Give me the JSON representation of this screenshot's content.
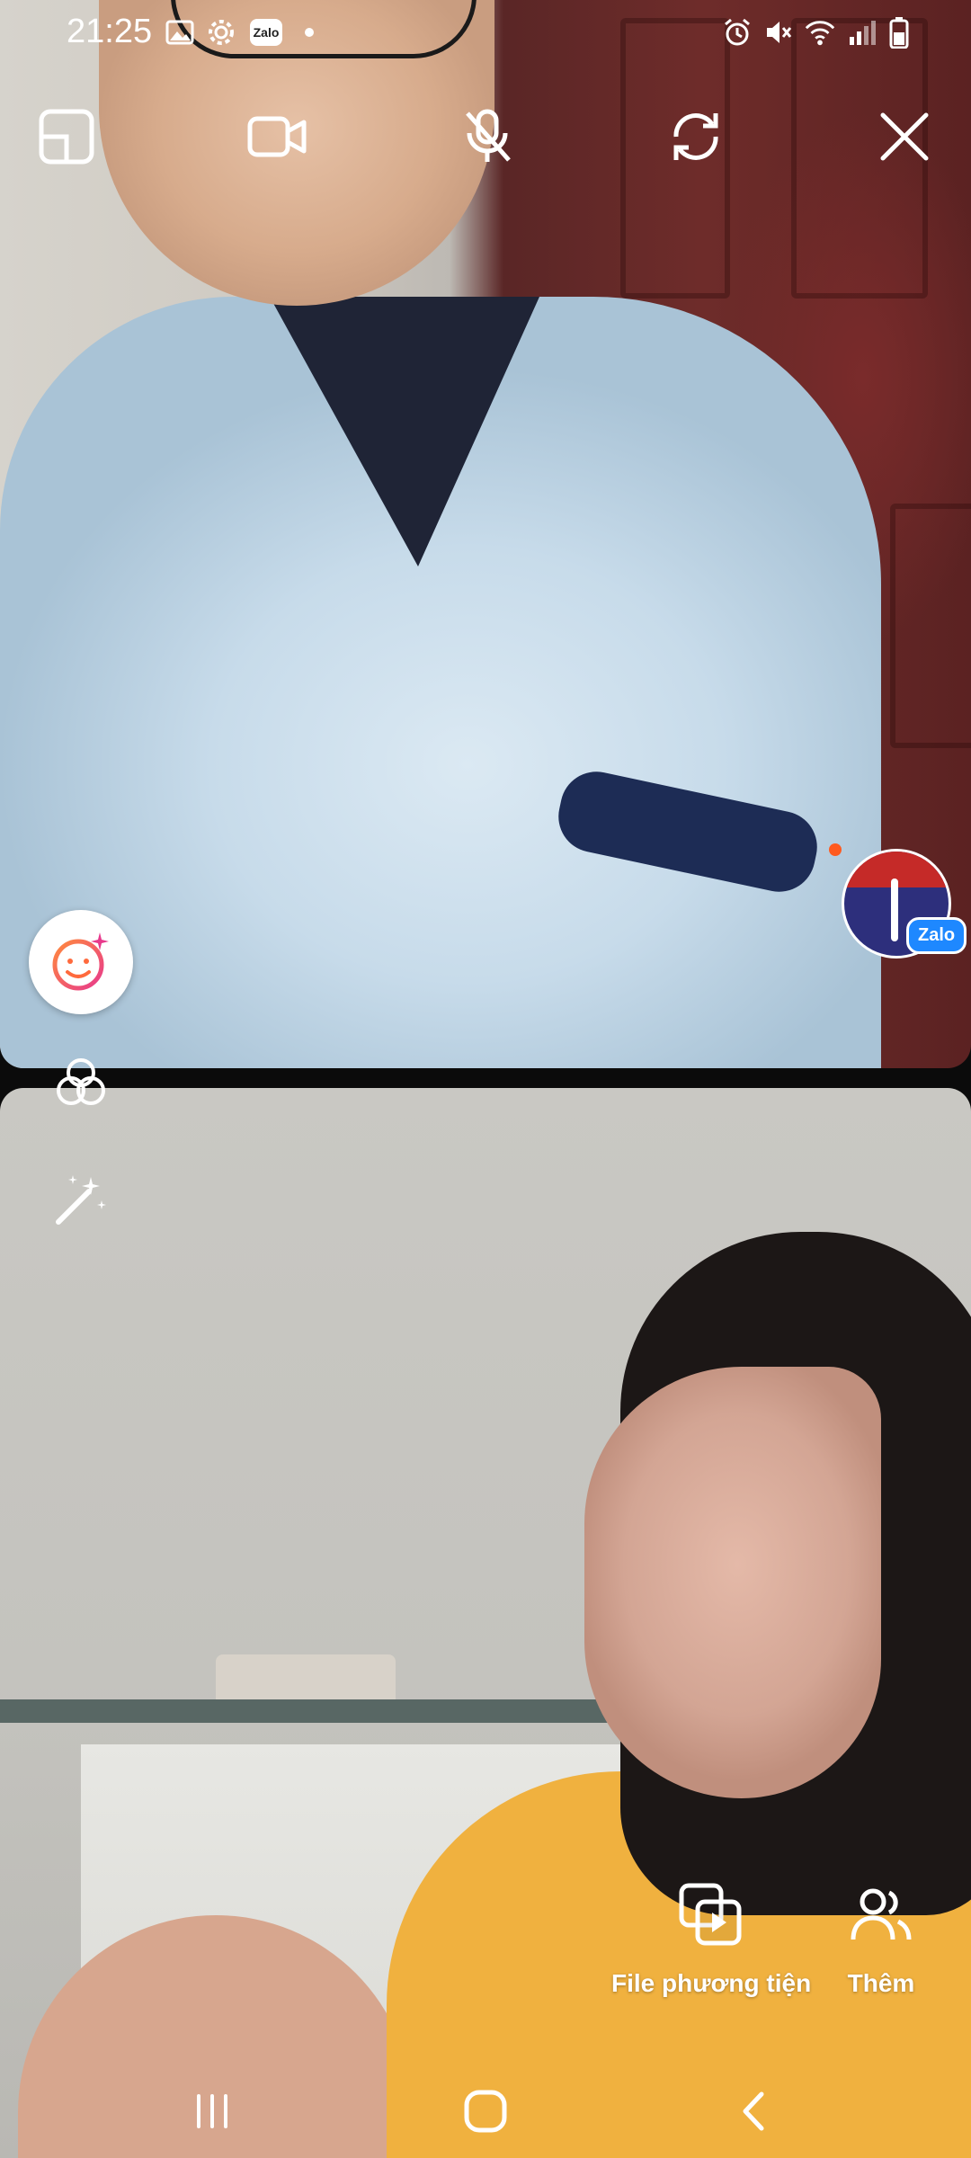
{
  "status_bar": {
    "time": "21:25",
    "left_icons": [
      "gallery-icon",
      "settings-icon",
      "zalo-notification-icon",
      "notification-dot"
    ],
    "zalo_badge_text": "Zalo",
    "right_icons": [
      "alarm-icon",
      "mute-icon",
      "wifi-icon",
      "signal-icon",
      "battery-icon"
    ]
  },
  "call_controls": {
    "items": [
      {
        "name": "layout-toggle",
        "icon": "pip-layout-icon"
      },
      {
        "name": "video",
        "icon": "video-camera-icon"
      },
      {
        "name": "microphone",
        "icon": "mic-off-icon"
      },
      {
        "name": "switch-camera",
        "icon": "rotate-camera-icon"
      },
      {
        "name": "end-call",
        "icon": "close-icon"
      }
    ]
  },
  "effects": {
    "items": [
      {
        "name": "beauty",
        "icon": "beauty-face-icon",
        "accent": "#ff6a3d"
      },
      {
        "name": "filters",
        "icon": "filter-circles-icon"
      },
      {
        "name": "magic",
        "icon": "magic-wand-icon"
      }
    ]
  },
  "remote_user": {
    "avatar_icon": "ministry-of-health-emblem",
    "badge_text": "Zalo",
    "online_color": "#ff5a1f"
  },
  "bottom_actions": {
    "media": {
      "label": "File phương tiện",
      "icon": "media-file-icon"
    },
    "more": {
      "label": "Thêm",
      "icon": "add-people-icon"
    }
  },
  "navigation": {
    "recent": "recent-apps-icon",
    "home": "home-icon",
    "back": "back-icon"
  }
}
